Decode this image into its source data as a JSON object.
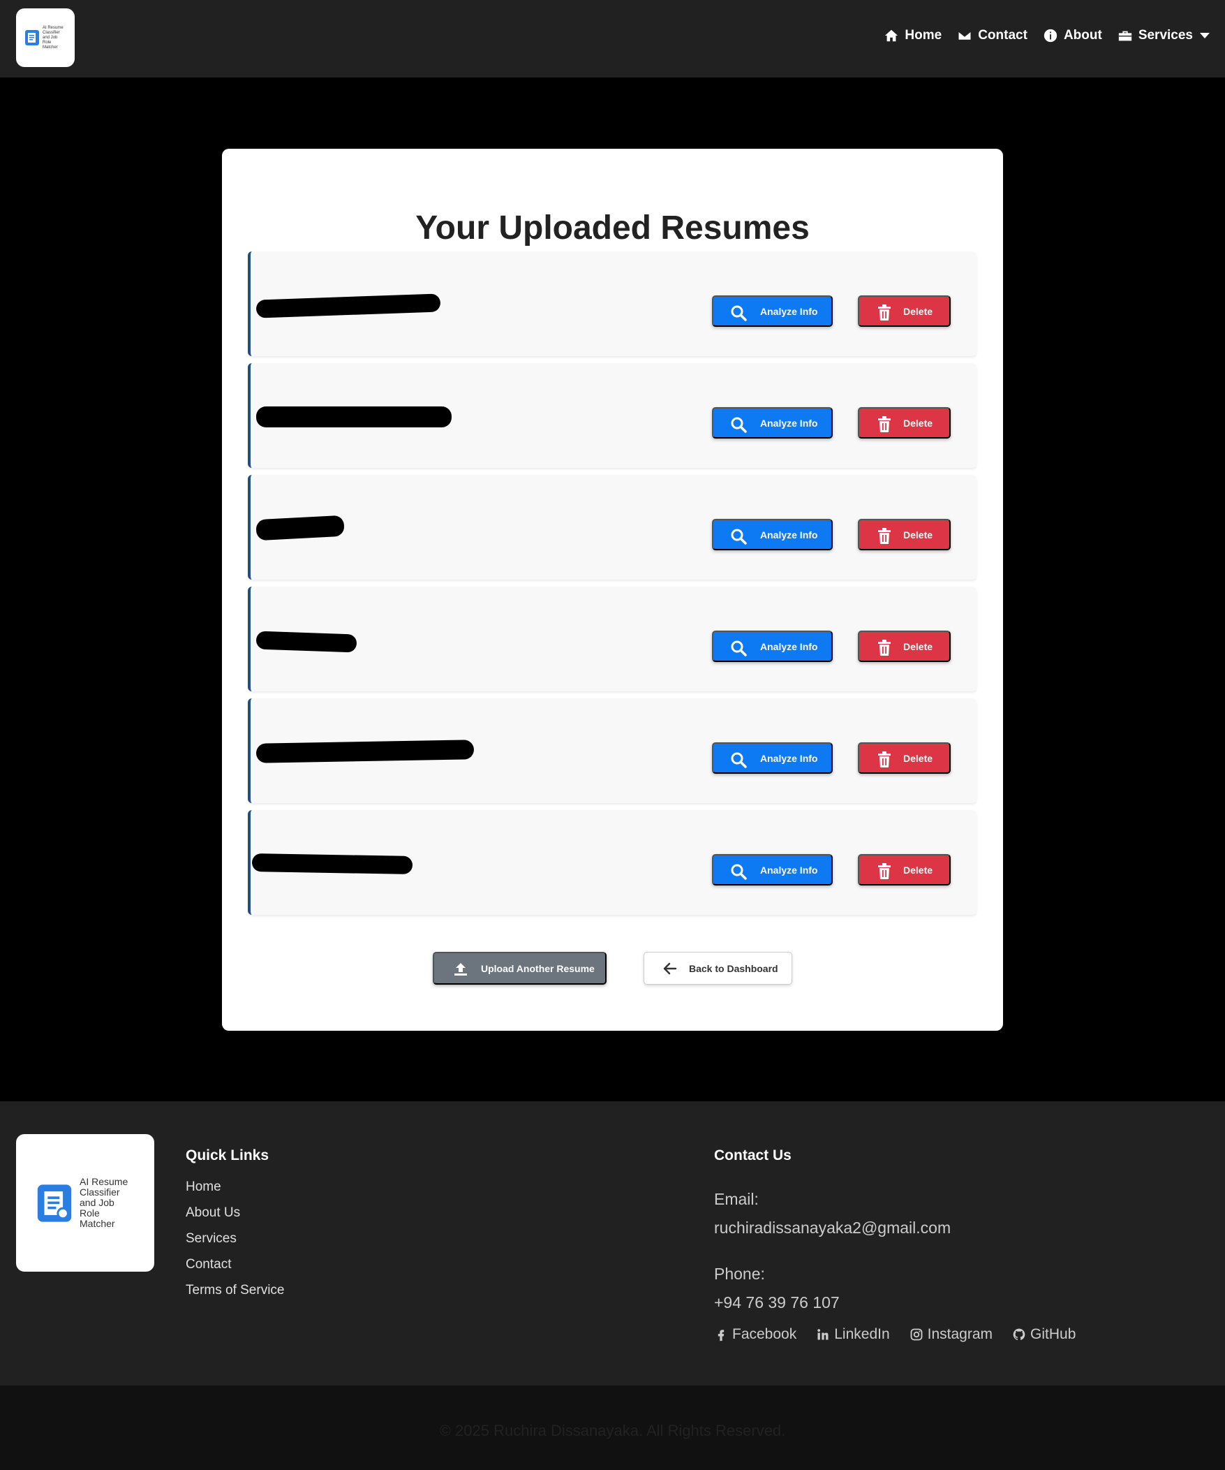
{
  "nav": {
    "logo_text": "AI Resume Classifier and Job Role Matcher",
    "items": [
      {
        "label": "Home",
        "icon": "home-icon"
      },
      {
        "label": "Contact",
        "icon": "envelope-icon"
      },
      {
        "label": "About",
        "icon": "info-icon"
      },
      {
        "label": "Services",
        "icon": "briefcase-icon"
      }
    ]
  },
  "main": {
    "title": "Your Uploaded Resumes",
    "resumes": [
      {
        "analyze_label": "Analyze Info",
        "delete_label": "Delete"
      },
      {
        "analyze_label": "Analyze Info",
        "delete_label": "Delete"
      },
      {
        "analyze_label": "Analyze Info",
        "delete_label": "Delete"
      },
      {
        "analyze_label": "Analyze Info",
        "delete_label": "Delete"
      },
      {
        "analyze_label": "Analyze Info",
        "delete_label": "Delete"
      },
      {
        "analyze_label": "Analyze Info",
        "delete_label": "Delete"
      }
    ],
    "upload_label": "Upload Another Resume",
    "back_label": "Back to Dashboard"
  },
  "footer": {
    "logo_text": "AI Resume Classifier and Job Role Matcher",
    "quick_links_title": "Quick Links",
    "quick_links": [
      "Home",
      "About Us",
      "Services",
      "Contact",
      "Terms of Service"
    ],
    "contact_title": "Contact Us",
    "email_label": "Email:",
    "email": "ruchiradissanayaka2@gmail.com",
    "phone_label": "Phone:",
    "phone": "+94 76 39 76 107",
    "socials": [
      {
        "label": "Facebook",
        "icon": "facebook-icon"
      },
      {
        "label": "LinkedIn",
        "icon": "linkedin-icon"
      },
      {
        "label": "Instagram",
        "icon": "instagram-icon"
      },
      {
        "label": "GitHub",
        "icon": "github-icon"
      }
    ],
    "copyright": "© 2025 Ruchira Dissanayaka. All Rights Reserved."
  },
  "colors": {
    "primary": "#0d79f2",
    "danger": "#dc3545",
    "secondary": "#6c757d",
    "accent_border": "#1f4f82"
  }
}
